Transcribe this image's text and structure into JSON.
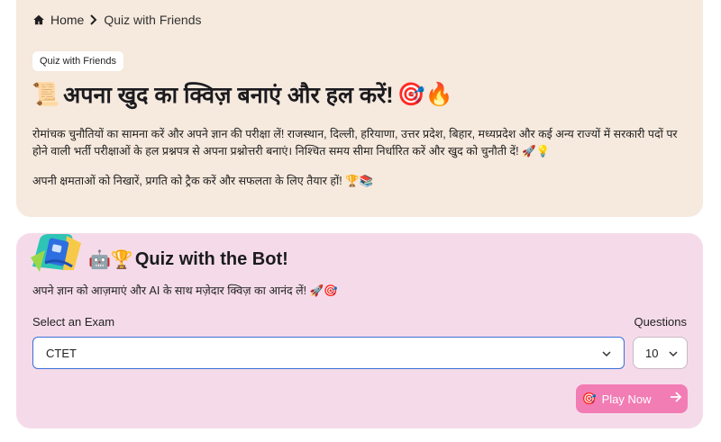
{
  "breadcrumb": {
    "home_label": "Home",
    "current_label": "Quiz with Friends"
  },
  "hero": {
    "tag": "Quiz with Friends",
    "title_emoji_left": "📜",
    "title": "अपना खुद का क्विज़ बनाएं और हल करें!",
    "title_emoji_right": "🎯🔥",
    "description": "रोमांचक चुनौतियों का सामना करें और अपने ज्ञान की परीक्षा लें! राजस्थान, दिल्ली, हरियाणा, उत्तर प्रदेश, बिहार, मध्यप्रदेश और कई अन्य राज्यों में सरकारी पदों पर होने वाली भर्ती परीक्षाओं के हल प्रश्नपत्र से अपना प्रश्नोत्तरी बनाएं। निश्चित समय सीमा निर्धारित करें और खुद को चुनौती दें! 🚀💡",
    "description2": "अपनी क्षमताओं को निखारें, प्रगति को ट्रैक करें और सफलता के लिए तैयार हों! 🏆📚"
  },
  "bot": {
    "title_emoji": "🤖🏆",
    "title": "Quiz with the Bot!",
    "subtitle": "अपने ज्ञान को आज़माएं और AI के साथ मज़ेदार क्विज़ का आनंद लें! 🚀🎯",
    "exam_label": "Select an Exam",
    "exam_value": "CTET",
    "questions_label": "Questions",
    "questions_value": "10",
    "play_emoji": "🎯",
    "play_label": "Play Now"
  },
  "colors": {
    "hero_bg": "#f6e9dd",
    "bot_bg": "#f5dbe9",
    "accent_pink": "#f27cb4",
    "focus_blue": "#3b6fd8"
  }
}
